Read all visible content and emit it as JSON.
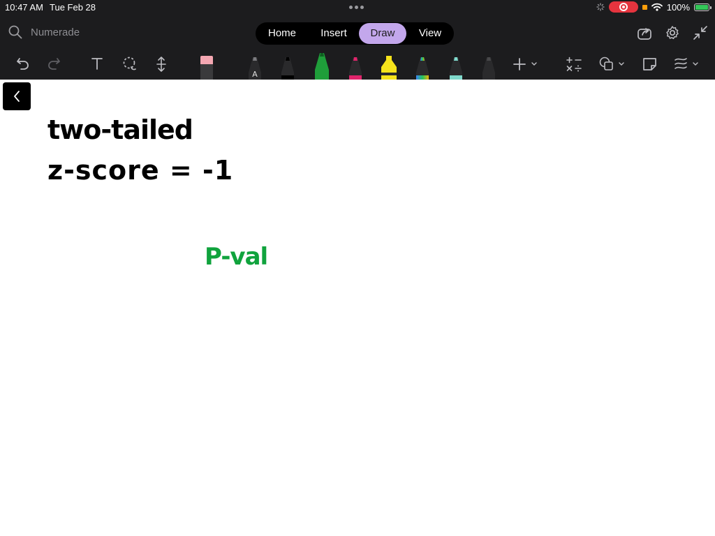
{
  "status_bar": {
    "time": "10:47 AM",
    "date": "Tue Feb 28",
    "battery": "100%"
  },
  "header": {
    "search_placeholder": "Numerade",
    "tabs": [
      {
        "label": "Home"
      },
      {
        "label": "Insert"
      },
      {
        "label": "Draw",
        "active": true
      },
      {
        "label": "View"
      }
    ]
  },
  "toolbar": {
    "tools": [
      "undo-icon",
      "redo-icon",
      "text-tool-icon",
      "lasso-icon",
      "space-insert-icon",
      "eraser-icon",
      "pen-black-a",
      "pen-black",
      "pen-green",
      "pen-magenta",
      "highlighter-yellow",
      "pen-rainbow",
      "pen-teal",
      "pen-dark",
      "add-pen-icon",
      "math-icon",
      "shapes-icon",
      "sticker-icon",
      "ink-to-shape-icon"
    ],
    "pen_colors": {
      "black": "#1a1a1a",
      "green": "#1f9e3a",
      "magenta": "#e0246b",
      "yellow": "#f6e31b",
      "teal": "#7fd9cc"
    }
  },
  "canvas": {
    "ink": [
      {
        "text": "two-tailed",
        "color": "#000000"
      },
      {
        "text": "z-score = -1",
        "color": "#000000"
      },
      {
        "text": "P-val",
        "color": "#10a33d"
      }
    ]
  },
  "colors": {
    "toolbar_bg": "#1c1c1e",
    "active_tab": "#c3a7ec",
    "record": "#e5343e",
    "battery": "#34c759"
  }
}
